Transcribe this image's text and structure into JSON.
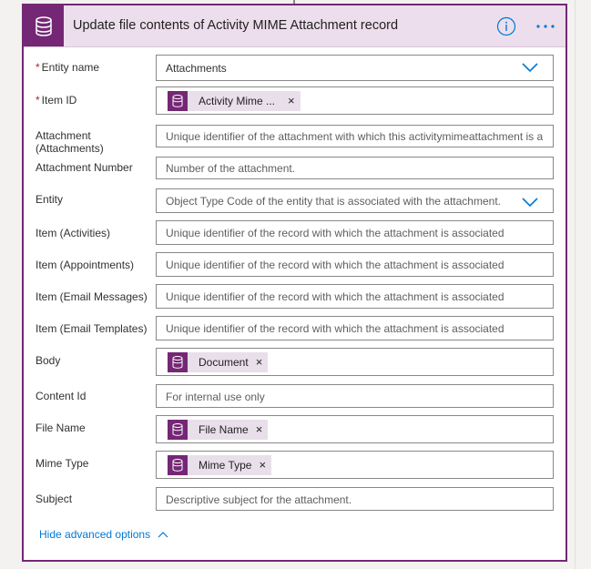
{
  "card": {
    "title": "Update file contents of Activity MIME Attachment record",
    "header_icon": "database-icon",
    "info_icon": "info-icon",
    "more_label": "···",
    "accent_color": "#742774"
  },
  "fields": {
    "entity_name": {
      "label": "Entity name",
      "required": "*",
      "value": "Attachments"
    },
    "item_id": {
      "label": "Item ID",
      "required": "*",
      "token": "Activity Mime ..."
    },
    "attachment": {
      "label": "Attachment (Attachments)",
      "placeholder": "Unique identifier of the attachment with which this activitymimeattachment is a"
    },
    "attachment_number": {
      "label": "Attachment Number",
      "placeholder": "Number of the attachment."
    },
    "entity": {
      "label": "Entity",
      "placeholder": "Object Type Code of the entity that is associated with the attachment."
    },
    "item_activities": {
      "label": "Item (Activities)",
      "placeholder": "Unique identifier of the record with which the attachment is associated"
    },
    "item_appointments": {
      "label": "Item (Appointments)",
      "placeholder": "Unique identifier of the record with which the attachment is associated"
    },
    "item_email_messages": {
      "label": "Item (Email Messages)",
      "placeholder": "Unique identifier of the record with which the attachment is associated"
    },
    "item_email_templates": {
      "label": "Item (Email Templates)",
      "placeholder": "Unique identifier of the record with which the attachment is associated"
    },
    "body": {
      "label": "Body",
      "token": "Document"
    },
    "content_id": {
      "label": "Content Id",
      "placeholder": "For internal use only"
    },
    "file_name": {
      "label": "File Name",
      "token": "File Name"
    },
    "mime_type": {
      "label": "Mime Type",
      "token": "Mime Type"
    },
    "subject": {
      "label": "Subject",
      "placeholder": "Descriptive subject for the attachment."
    }
  },
  "footer": {
    "hide_advanced": "Hide advanced options"
  },
  "token_remove": "×"
}
